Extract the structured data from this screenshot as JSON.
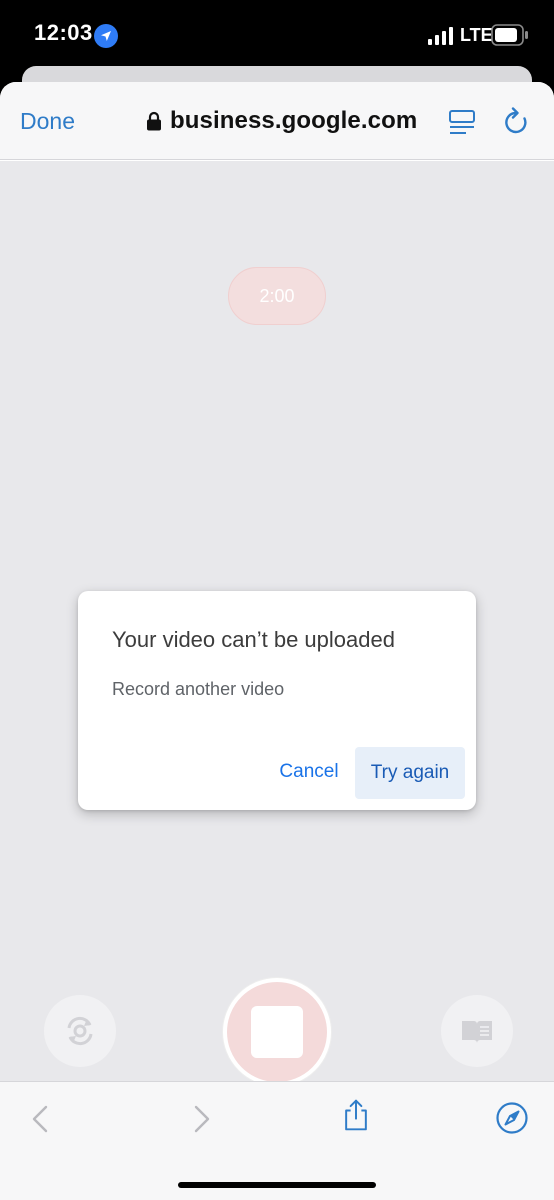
{
  "status_bar": {
    "time": "12:03",
    "network": "LTE",
    "icons": [
      "location-arrow-icon",
      "signal-bars-icon",
      "battery-icon"
    ]
  },
  "browser": {
    "done_label": "Done",
    "url": "business.google.com",
    "icons": [
      "lock-icon",
      "reader-view-icon",
      "reload-icon"
    ]
  },
  "recorder": {
    "timer": "2:00",
    "buttons": [
      "flip-camera-icon",
      "record-stop-button",
      "book-icon"
    ]
  },
  "dialog": {
    "title": "Your video can’t be uploaded",
    "message": "Record another video",
    "cancel_label": "Cancel",
    "retry_label": "Try again"
  },
  "toolbar": {
    "icons": [
      "back-icon",
      "forward-icon",
      "share-icon",
      "compass-icon"
    ]
  },
  "colors": {
    "accent": "#2f7cc8",
    "dialog_button": "#1a73e8",
    "retry_bg": "#e7eff9",
    "record_fill": "#f4dada"
  }
}
